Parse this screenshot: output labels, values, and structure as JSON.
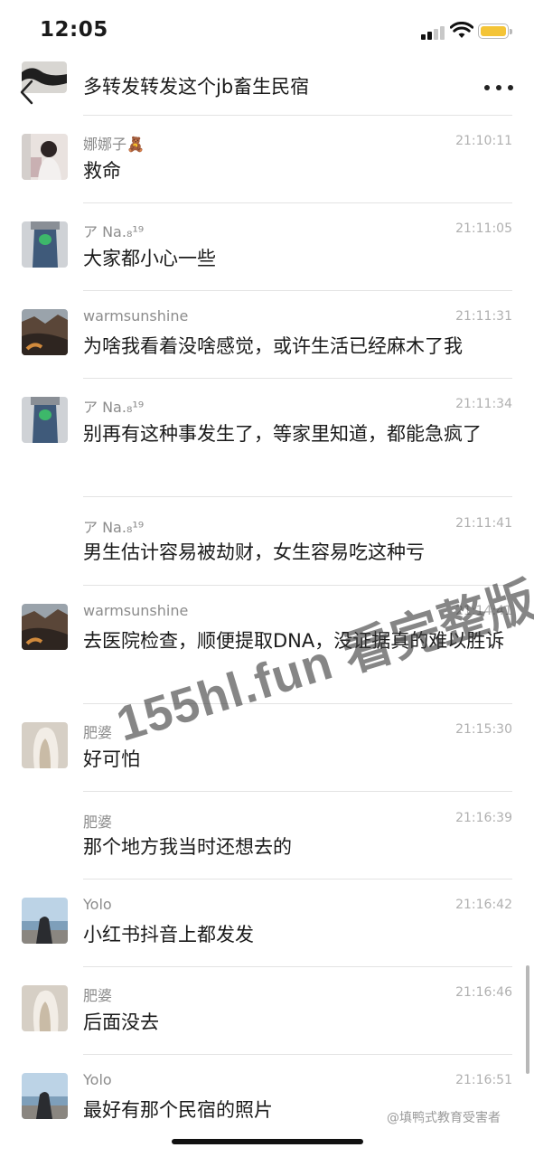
{
  "status_bar": {
    "time": "12:05"
  },
  "header": {
    "previous_message": "多转发转发这个jb畜生民宿"
  },
  "messages": [
    {
      "nick": "娜娜子🧸",
      "time": "21:10:11",
      "text": "救命",
      "avatar": "girl-photo"
    },
    {
      "nick": "ア Na.₈¹⁹",
      "time": "21:11:05",
      "text": "大家都小心一些",
      "avatar": "green-bag-photo"
    },
    {
      "nick": "warmsunshine",
      "time": "21:11:31",
      "text": "为啥我看着没啥感觉，或许生活已经麻木了我",
      "avatar": "landscape-photo"
    },
    {
      "nick": "ア Na.₈¹⁹",
      "time": "21:11:34",
      "text": "别再有这种事发生了，等家里知道，都能急疯了",
      "avatar": "green-bag-photo"
    },
    {
      "nick": "ア Na.₈¹⁹",
      "time": "21:11:41",
      "text": "男生估计容易被劫财，女生容易吃这种亏",
      "avatar": ""
    },
    {
      "nick": "warmsunshine",
      "time": "21:14:41",
      "text": "去医院检查，顺便提取DNA，没证据真的难以胜诉",
      "avatar": "landscape-photo"
    },
    {
      "nick": "肥婆",
      "time": "21:15:30",
      "text": "好可怕",
      "avatar": "longhair-photo"
    },
    {
      "nick": "肥婆",
      "time": "21:16:39",
      "text": "那个地方我当时还想去的",
      "avatar": ""
    },
    {
      "nick": "Yolo",
      "time": "21:16:42",
      "text": "小红书抖音上都发发",
      "avatar": "sea-photo"
    },
    {
      "nick": "肥婆",
      "time": "21:16:46",
      "text": "后面没去",
      "avatar": "longhair-photo"
    },
    {
      "nick": "Yolo",
      "time": "21:16:51",
      "text": "最好有那个民宿的照片",
      "avatar": "sea-photo"
    }
  ],
  "watermark": {
    "text": "155hl.fun 看完整版"
  },
  "corner_watermark": "@填鸭式教育受害者",
  "colors": {
    "battery": "#f4c437",
    "nick": "#8c8c8c",
    "time": "#b0b0b0",
    "divider": "#e3e3e3"
  }
}
